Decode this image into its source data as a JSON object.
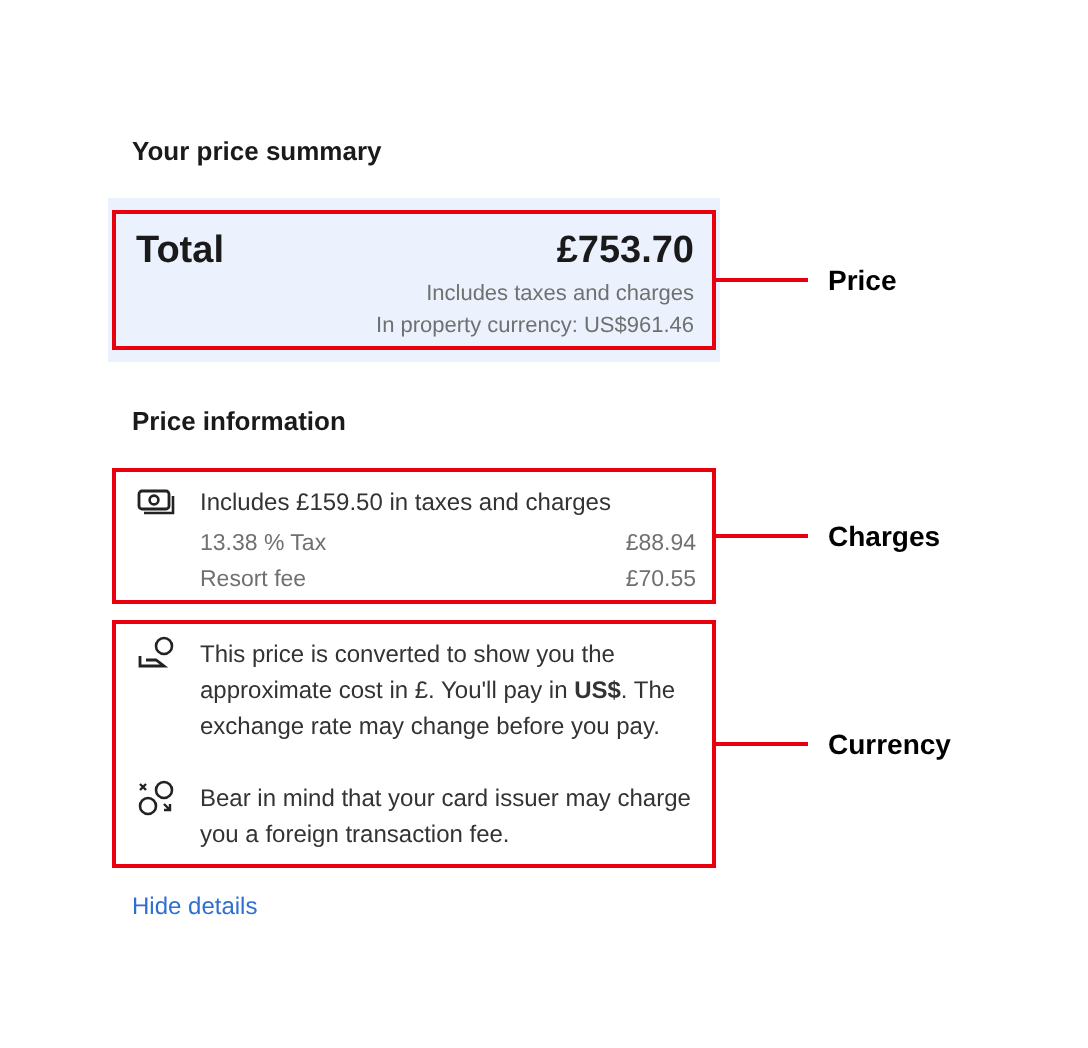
{
  "heading": "Your price summary",
  "total": {
    "label": "Total",
    "amount": "£753.70",
    "notes": [
      "Includes taxes and charges",
      "In property currency: US$961.46"
    ]
  },
  "info_heading": "Price information",
  "charges": {
    "summary": "Includes £159.50 in taxes and charges",
    "lines": [
      {
        "label": "13.38 % Tax",
        "amount": "£88.94"
      },
      {
        "label": "Resort fee",
        "amount": "£70.55"
      }
    ]
  },
  "currency_notes": [
    {
      "kind": "converted",
      "text": "This price is converted to show you the approximate cost in £. You'll pay in **US$**. The exchange rate may change before you pay."
    },
    {
      "kind": "exchange",
      "text": "Bear in mind that your card issuer may charge you a foreign transaction fee."
    }
  ],
  "link": "Hide details",
  "annotations": {
    "price": "Price",
    "charges": "Charges",
    "currency": "Currency"
  }
}
